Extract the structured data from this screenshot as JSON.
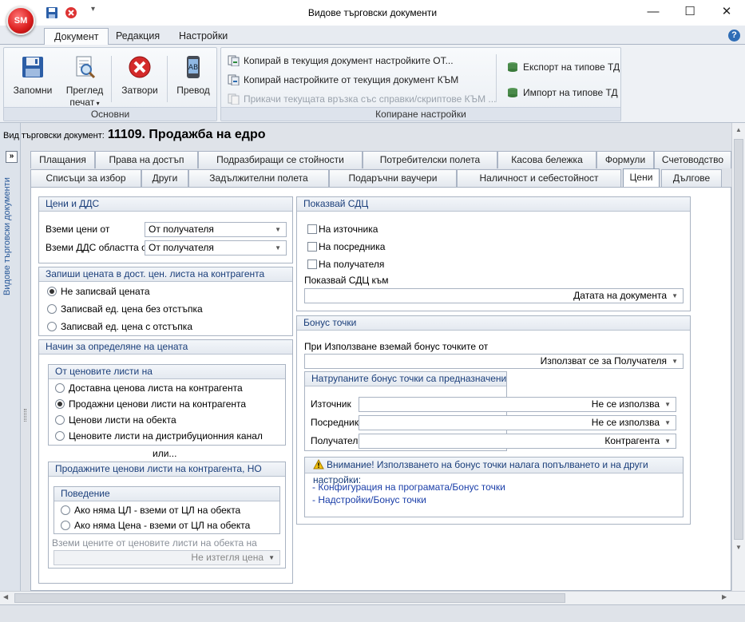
{
  "window": {
    "title": "Видове търговски документи",
    "logo_text": "SM",
    "minimize": "—",
    "maximize": "☐",
    "close": "✕"
  },
  "ribbon_tabs": [
    "Документ",
    "Редакция",
    "Настройки"
  ],
  "ribbon": {
    "basic": {
      "caption": "Основни",
      "save": "Запомни",
      "preview_line1": "Преглед",
      "preview_line2": "печат",
      "close": "Затвори",
      "translate": "Превод"
    },
    "copy": {
      "caption": "Копиране настройки",
      "copy_to_current": "Копирай в текущия документ настройките ОТ...",
      "copy_from_current": "Копирай настройките от текущия документ КЪМ",
      "attach_link": "Прикачи текущата връзка със справки/скриптове КЪМ ...",
      "export": "Експорт на типове ТД",
      "import": "Импорт на типове ТД"
    }
  },
  "sidebar": {
    "expand": "»",
    "label": "Видове търговски документи"
  },
  "doc": {
    "label": "Вид търговски документ:",
    "value": "11109. Продажба на едро"
  },
  "tabs_row1": [
    "Плащания",
    "Права на достъп",
    "Подразбиращи се стойности",
    "Потребителски полета",
    "Касова бележка",
    "Формули",
    "Счетоводство"
  ],
  "tabs_row2": [
    "Списъци за избор",
    "Други",
    "Задължителни полета",
    "Подаръчни ваучери",
    "Наличност и себестойност",
    "Цени",
    "Дългове"
  ],
  "prices_vat": {
    "header": "Цени и ДДС",
    "take_prices_label": "Вземи цени от",
    "take_prices_value": "От получателя",
    "take_vat_label": "Вземи ДДС областта от",
    "take_vat_value": "От получателя"
  },
  "save_price": {
    "header": "Запиши цената в дост. цен. листа на контрагента",
    "options": [
      "Не записвай цената",
      "Записвай ед. цена без отстъпка",
      "Записвай ед. цена с отстъпка"
    ]
  },
  "price_method": {
    "header": "Начин за определяне на цената",
    "from_lists_header": "От ценовите листи на",
    "from_lists_options": [
      "Доставна ценова листа на контрагента",
      "Продажни ценови листи на контрагента",
      "Ценови листи на обекта",
      "Ценовите листи на дистрибуционния канал"
    ],
    "or_text": "или...",
    "sales_header": "Продажните ценови листи на контрагента, НО",
    "behavior_header": "Поведение",
    "behavior_options": [
      "Ако няма ЦЛ - вземи от ЦЛ на обекта",
      "Ако няма Цена - вземи от ЦЛ на обекта"
    ],
    "take_from_label": "Вземи цените от ценовите листи на обекта на",
    "take_from_value": "Не изтегля цена"
  },
  "show_sdc": {
    "header": "Показвай СДЦ",
    "checks": [
      "На източника",
      "На посредника",
      "На получателя"
    ],
    "to_label": "Показвай СДЦ към",
    "to_value": "Датата на документа"
  },
  "bonus": {
    "header": "Бонус точки",
    "use_label": "При Използване вземай бонус точките от",
    "use_value": "Използват се за Получателя",
    "accum_header": "Натрупаните бонус точки са предназначени",
    "rows": [
      {
        "label": "Източник",
        "value": "Не се използва"
      },
      {
        "label": "Посредник",
        "value": "Не се използва"
      },
      {
        "label": "Получател",
        "value": "Контрагента"
      }
    ],
    "warning": "Внимание! Използването на бонус точки налага попълването и на други настройки:",
    "links": [
      "- Конфигурация на програмата/Бонус точки",
      "- Надстройки/Бонус точки"
    ]
  },
  "colors": {
    "accent": "#1a3e7a",
    "link": "#1a3ea8",
    "logo": "#d22222"
  }
}
